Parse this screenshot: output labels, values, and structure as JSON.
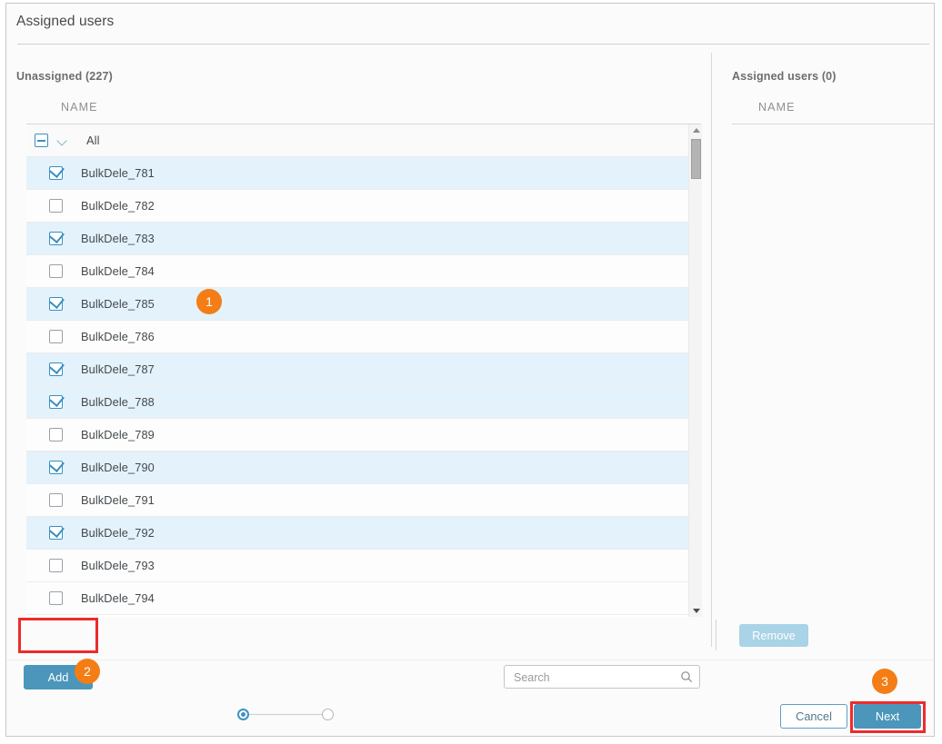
{
  "dialog": {
    "title": "Assigned users"
  },
  "left_panel": {
    "heading": "Unassigned (227)",
    "column_header": "NAME",
    "all_row": {
      "label": "All",
      "checkbox_state": "indeterminate",
      "expand_icon": "chevron-down-icon"
    },
    "rows": [
      {
        "label": "BulkDele_781",
        "checked": true
      },
      {
        "label": "BulkDele_782",
        "checked": false
      },
      {
        "label": "BulkDele_783",
        "checked": true
      },
      {
        "label": "BulkDele_784",
        "checked": false
      },
      {
        "label": "BulkDele_785",
        "checked": true
      },
      {
        "label": "BulkDele_786",
        "checked": false
      },
      {
        "label": "BulkDele_787",
        "checked": true
      },
      {
        "label": "BulkDele_788",
        "checked": true
      },
      {
        "label": "BulkDele_789",
        "checked": false
      },
      {
        "label": "BulkDele_790",
        "checked": true
      },
      {
        "label": "BulkDele_791",
        "checked": false
      },
      {
        "label": "BulkDele_792",
        "checked": true
      },
      {
        "label": "BulkDele_793",
        "checked": false
      },
      {
        "label": "BulkDele_794",
        "checked": false
      }
    ],
    "add_button": "Add",
    "search": {
      "value": "",
      "placeholder": "Search",
      "icon": "search-icon"
    }
  },
  "right_panel": {
    "heading": "Assigned users (0)",
    "column_header": "NAME",
    "rows": [],
    "remove_button": "Remove",
    "remove_disabled": true
  },
  "footer": {
    "cancel_button": "Cancel",
    "next_button": "Next",
    "stepper": {
      "total": 2,
      "current": 1
    }
  },
  "annotations": [
    {
      "number": "1"
    },
    {
      "number": "2"
    },
    {
      "number": "3"
    }
  ],
  "colors": {
    "accent": "#4b96ba",
    "selected_row": "#e3f2fb",
    "annotation": "#f47d16",
    "highlight_box": "#ee2b2b",
    "disabled_button": "#a9d3e6"
  }
}
